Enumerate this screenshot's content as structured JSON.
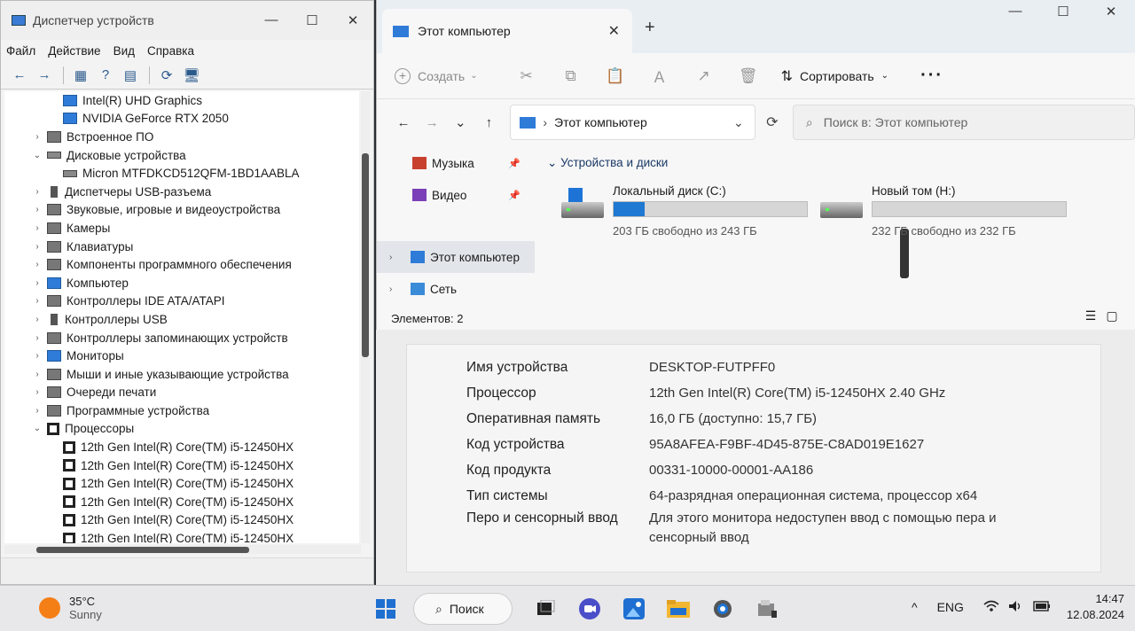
{
  "devmgr": {
    "title": "Диспетчер устройств",
    "window_controls": [
      "—",
      "☐",
      "✕"
    ],
    "menu": [
      "Файл",
      "Действие",
      "Вид",
      "Справка"
    ],
    "toolbar": [
      "←",
      "→",
      "▦",
      "?",
      "▤",
      "⟳",
      "🖥"
    ],
    "tree": [
      {
        "label": "Intel(R) UHD Graphics",
        "icon": "monitor-icon",
        "level": 2,
        "expander": ""
      },
      {
        "label": "NVIDIA GeForce RTX 2050",
        "icon": "monitor-icon",
        "level": 2,
        "expander": ""
      },
      {
        "label": "Встроенное ПО",
        "icon": "firmware-icon",
        "level": 1,
        "expander": "›"
      },
      {
        "label": "Дисковые устройства",
        "icon": "disk-icon",
        "level": 1,
        "expander": "⌄"
      },
      {
        "label": "Micron MTFDKCD512QFM-1BD1AABLA",
        "icon": "disk-icon",
        "level": 2,
        "expander": ""
      },
      {
        "label": "Диспетчеры USB-разъема",
        "icon": "usb-icon",
        "level": 1,
        "expander": "›"
      },
      {
        "label": "Звуковые, игровые и видеоустройства",
        "icon": "speaker-icon",
        "level": 1,
        "expander": "›"
      },
      {
        "label": "Камеры",
        "icon": "camera-icon",
        "level": 1,
        "expander": "›"
      },
      {
        "label": "Клавиатуры",
        "icon": "keyboard-icon",
        "level": 1,
        "expander": "›"
      },
      {
        "label": "Компоненты программного обеспечения",
        "icon": "software-component-icon",
        "level": 1,
        "expander": "›"
      },
      {
        "label": "Компьютер",
        "icon": "monitor-icon",
        "level": 1,
        "expander": "›"
      },
      {
        "label": "Контроллеры IDE ATA/ATAPI",
        "icon": "ide-icon",
        "level": 1,
        "expander": "›"
      },
      {
        "label": "Контроллеры USB",
        "icon": "usb-icon",
        "level": 1,
        "expander": "›"
      },
      {
        "label": "Контроллеры запоминающих устройств",
        "icon": "storage-controller-icon",
        "level": 1,
        "expander": "›"
      },
      {
        "label": "Мониторы",
        "icon": "monitor-icon",
        "level": 1,
        "expander": "›"
      },
      {
        "label": "Мыши и иные указывающие устройства",
        "icon": "mouse-icon",
        "level": 1,
        "expander": "›"
      },
      {
        "label": "Очереди печати",
        "icon": "printer-icon",
        "level": 1,
        "expander": "›"
      },
      {
        "label": "Программные устройства",
        "icon": "software-device-icon",
        "level": 1,
        "expander": "›"
      },
      {
        "label": "Процессоры",
        "icon": "cpu-icon",
        "level": 1,
        "expander": "⌄"
      },
      {
        "label": "12th Gen Intel(R) Core(TM) i5-12450HX",
        "icon": "cpu-icon",
        "level": 2,
        "expander": ""
      },
      {
        "label": "12th Gen Intel(R) Core(TM) i5-12450HX",
        "icon": "cpu-icon",
        "level": 2,
        "expander": ""
      },
      {
        "label": "12th Gen Intel(R) Core(TM) i5-12450HX",
        "icon": "cpu-icon",
        "level": 2,
        "expander": ""
      },
      {
        "label": "12th Gen Intel(R) Core(TM) i5-12450HX",
        "icon": "cpu-icon",
        "level": 2,
        "expander": ""
      },
      {
        "label": "12th Gen Intel(R) Core(TM) i5-12450HX",
        "icon": "cpu-icon",
        "level": 2,
        "expander": ""
      },
      {
        "label": "12th Gen Intel(R) Core(TM) i5-12450HX",
        "icon": "cpu-icon",
        "level": 2,
        "expander": ""
      }
    ]
  },
  "explorer": {
    "tab_title": "Этот компьютер",
    "tab_close": "✕",
    "new_tab": "+",
    "window_controls": [
      "—",
      "☐",
      "✕"
    ],
    "command_bar": {
      "create_label": "Создать",
      "tools": [
        "✂",
        "⧉",
        "📋",
        "Ａ",
        "↗",
        "🗑"
      ],
      "sort_label": "Сортировать",
      "more": "···"
    },
    "address": {
      "back": "←",
      "forward": "→",
      "recent": "⌄",
      "up": "↑",
      "path": "Этот компьютер",
      "refresh": "⟳",
      "search_placeholder": "Поиск в: Этот компьютер"
    },
    "nav_pane": {
      "quick": [
        {
          "label": "Музыка",
          "icon": "music-folder-icon",
          "color": "#c8412f"
        },
        {
          "label": "Видео",
          "icon": "video-folder-icon",
          "color": "#7b3fb8"
        }
      ],
      "this_pc": "Этот компьютер",
      "network": "Сеть"
    },
    "group_header": "Устройства и диски",
    "drives": [
      {
        "name": "Локальный диск (C:)",
        "free_text": "203 ГБ свободно из 243 ГБ",
        "used_fraction": 0.16,
        "system": true
      },
      {
        "name": "Новый том (H:)",
        "free_text": "232 ГБ свободно из 232 ГБ",
        "used_fraction": 0.0,
        "system": false
      }
    ],
    "status": "Элементов: 2",
    "accent": "#1f78d1"
  },
  "system_info": [
    {
      "label": "Имя устройства",
      "value": "DESKTOP-FUTPFF0"
    },
    {
      "label": "Процессор",
      "value": "12th Gen Intel(R) Core(TM) i5-12450HX   2.40 GHz"
    },
    {
      "label": "Оперативная память",
      "value": "16,0 ГБ (доступно: 15,7 ГБ)"
    },
    {
      "label": "Код устройства",
      "value": "95A8AFEA-F9BF-4D45-875E-C8AD019E1627"
    },
    {
      "label": "Код продукта",
      "value": "00331-10000-00001-AA186"
    },
    {
      "label": "Тип системы",
      "value": "64-разрядная операционная система, процессор x64"
    },
    {
      "label": "Перо и сенсорный ввод",
      "value": "Для этого монитора недоступен ввод с помощью пера и сенсорный ввод"
    }
  ],
  "taskbar": {
    "weather_temp": "35°C",
    "weather_desc": "Sunny",
    "search_label": "Поиск",
    "apps": [
      "start-icon",
      "task-view-icon",
      "chat-icon",
      "photos-icon",
      "file-explorer-icon",
      "settings-icon",
      "device-manager-icon"
    ],
    "tray_overflow": "^",
    "language": "ENG",
    "tray_icons": [
      "wifi-icon",
      "volume-icon",
      "battery-icon"
    ],
    "time": "14:47",
    "date": "12.08.2024"
  }
}
